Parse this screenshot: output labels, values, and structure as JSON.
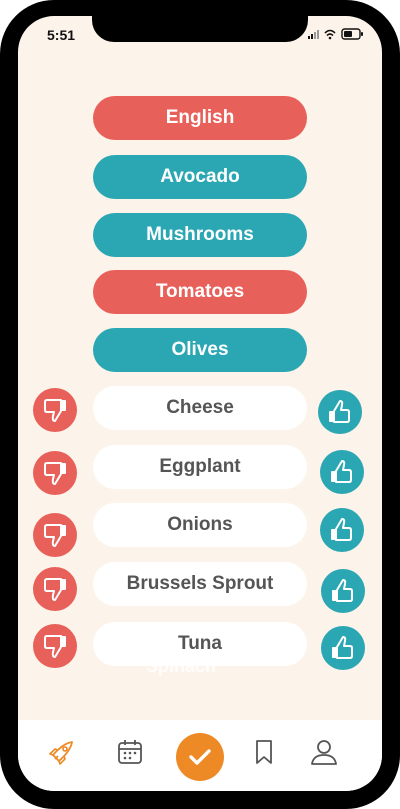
{
  "status": {
    "time": "5:51"
  },
  "colors": {
    "red": "#e8605a",
    "teal": "#2ba7b4",
    "orange": "#ee8a25",
    "background": "#fcf3ea"
  },
  "options": [
    {
      "label": "English",
      "color": "red"
    },
    {
      "label": "Avocado",
      "color": "teal"
    },
    {
      "label": "Mushrooms",
      "color": "teal"
    },
    {
      "label": "Tomatoes",
      "color": "red"
    },
    {
      "label": "Olives",
      "color": "teal"
    }
  ],
  "vote_items": [
    {
      "label": "Cheese"
    },
    {
      "label": "Eggplant"
    },
    {
      "label": "Onions"
    },
    {
      "label": "Brussels Sprout"
    },
    {
      "label": "Tuna"
    }
  ],
  "ghost_item": "Spinach",
  "nav": [
    {
      "icon": "rocket-icon"
    },
    {
      "icon": "calendar-icon"
    },
    {
      "icon": "check-icon"
    },
    {
      "icon": "bookmark-icon"
    },
    {
      "icon": "profile-icon"
    }
  ]
}
